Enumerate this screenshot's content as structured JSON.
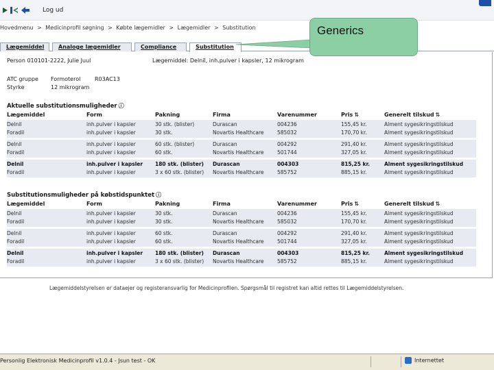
{
  "toolbar": {
    "logout_label": "Log ud"
  },
  "breadcrumb": [
    "Hovedmenu",
    ">",
    "Medicinprofil søgning",
    ">",
    "Købte lægemidler",
    ">",
    "Lægemidler",
    ">",
    "Substitution"
  ],
  "callout": {
    "text": "Generics"
  },
  "tabs": [
    "Lægemiddel",
    "Analoge lægemidler",
    "Compliance",
    "Substitution"
  ],
  "active_tab": "Substitution",
  "person": {
    "label": "Person",
    "value": "010101-2222, Julie Juul"
  },
  "drug": {
    "label": "Lægemiddel:",
    "value": "Delnil, inh.pulver i kapsler, 12 mikrogram"
  },
  "atc": {
    "label": "ATC gruppe",
    "name": "Formoterol",
    "code": "R03AC13"
  },
  "strength": {
    "label": "Styrke",
    "value": "12 mikrogram"
  },
  "columns": [
    "Lægemiddel",
    "Form",
    "Pakning",
    "Firma",
    "Varenummer",
    "Pris",
    "Generelt tilskud"
  ],
  "sections": [
    {
      "title": "Aktuelle substitutionsmuligheder",
      "groups": [
        {
          "bold": false,
          "rows": [
            [
              "Delnil",
              "inh.pulver i kapsler",
              "30 stk. (blister)",
              "Durascan",
              "004236",
              "155,45 kr.",
              "Alment sygesikringstilskud"
            ],
            [
              "Foradil",
              "inh.pulver i kapsler",
              "30 stk.",
              "Novartis Healthcare",
              "585032",
              "170,70 kr.",
              "Alment sygesikringstilskud"
            ]
          ]
        },
        {
          "bold": false,
          "rows": [
            [
              "Delnil",
              "inh.pulver i kapsler",
              "60 stk. (blister)",
              "Durascan",
              "004292",
              "291,40 kr.",
              "Alment sygesikringstilskud"
            ],
            [
              "Foradil",
              "inh.pulver i kapsler",
              "60 stk.",
              "Novartis Healthcare",
              "501744",
              "327,05 kr.",
              "Alment sygesikringstilskud"
            ]
          ]
        },
        {
          "bold": true,
          "rows": [
            [
              "Delnil",
              "inh.pulver i kapsler",
              "180 stk. (blister)",
              "Durascan",
              "004303",
              "815,25 kr.",
              "Alment sygesikringstilskud"
            ],
            [
              "Foradil",
              "inh.pulver i kapsler",
              "3 x 60 stk. (blister)",
              "Novartis Healthcare",
              "585752",
              "885,15 kr.",
              "Alment sygesikringstilskud"
            ]
          ]
        }
      ]
    },
    {
      "title": "Substitutionsmuligheder på købstidspunktet",
      "groups": [
        {
          "bold": false,
          "rows": [
            [
              "Delnil",
              "inh.pulver i kapsler",
              "30 stk.",
              "Durascan",
              "004236",
              "155,45 kr.",
              "Alment sygesikringstilskud"
            ],
            [
              "Foradil",
              "inh.pulver i kapsler",
              "30 stk.",
              "Novartis Healthcare",
              "585032",
              "170,70 kr.",
              "Alment sygesikringstilskud"
            ]
          ]
        },
        {
          "bold": false,
          "rows": [
            [
              "Delnil",
              "inh.pulver i kapsler",
              "60 stk.",
              "Durascan",
              "004292",
              "291,40 kr.",
              "Alment sygesikringstilskud"
            ],
            [
              "Foradil",
              "inh.pulver i kapsler",
              "60 stk.",
              "Novartis Healthcare",
              "501744",
              "327,05 kr.",
              "Alment sygesikringstilskud"
            ]
          ]
        },
        {
          "bold": true,
          "rows": [
            [
              "Delnil",
              "inh.pulver i kapsler",
              "180 stk. (blister)",
              "Durascan",
              "004303",
              "815,25 kr.",
              "Alment sygesikringstilskud"
            ],
            [
              "Foradil",
              "inh.pulver i kapsler",
              "3 x 60 stk. (blister)",
              "Novartis Healthcare",
              "585752",
              "885,15 kr.",
              "Alment sygesikringstilskud"
            ]
          ]
        }
      ]
    }
  ],
  "footer_note": "Lægemiddelstyrelsen er dataejer og registeransvarlig for Medicinprofilen. Spørgsmål til registret kan altid rettes til Lægemiddelstyrelsen.",
  "statusbar": {
    "left_text": "Personlig Elektronisk Medicinprofil v1.0.4 - Jsun test - OK",
    "zone_text": "Internettet"
  },
  "colors": {
    "callout_fill": "#8ccfa5",
    "row_band": "#e7ebf1",
    "accent_blue": "#1f4fa8"
  }
}
